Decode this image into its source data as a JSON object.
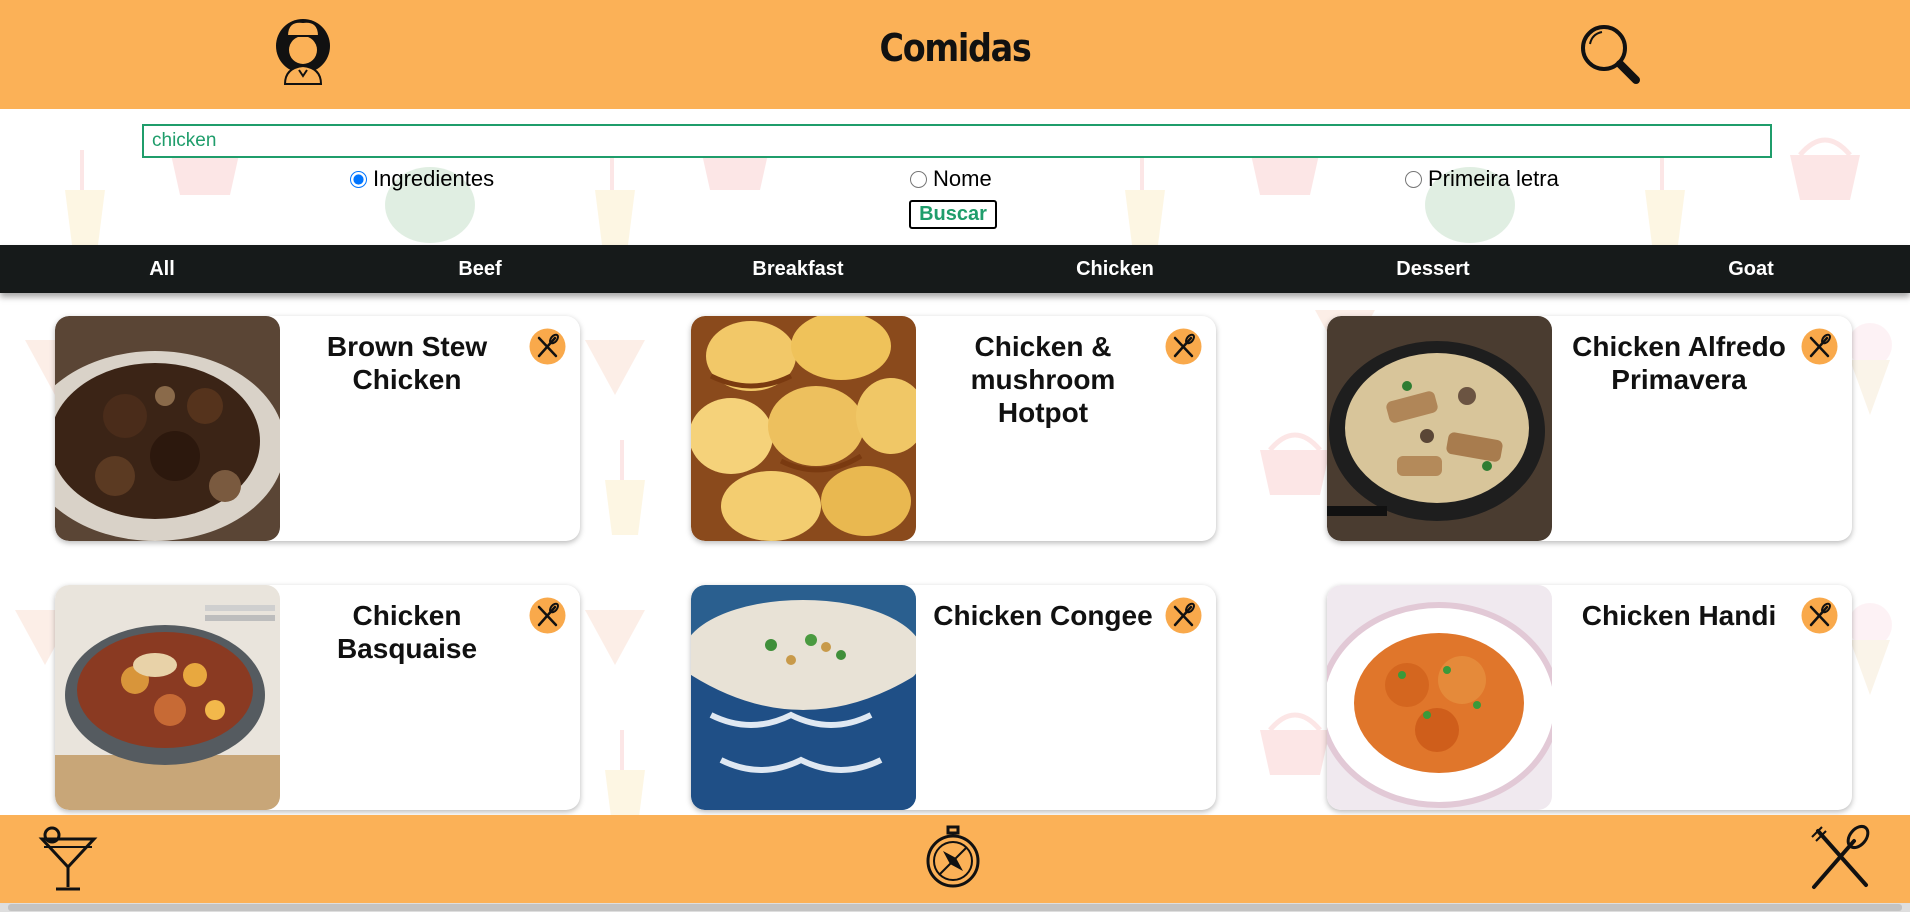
{
  "header": {
    "title": "Comidas",
    "profile_icon": "chef-profile-icon",
    "search_icon": "magnifier-icon"
  },
  "search": {
    "value": "chicken",
    "placeholder": "",
    "options": [
      {
        "label": "Ingredientes",
        "checked": true
      },
      {
        "label": "Nome",
        "checked": false
      },
      {
        "label": "Primeira letra",
        "checked": false
      }
    ],
    "button_label": "Buscar"
  },
  "categories": [
    "All",
    "Beef",
    "Breakfast",
    "Chicken",
    "Dessert",
    "Goat"
  ],
  "recipes": [
    {
      "title": "Brown Stew Chicken"
    },
    {
      "title": "Chicken & mushroom Hotpot"
    },
    {
      "title": "Chicken Alfredo Primavera"
    },
    {
      "title": "Chicken Basquaise"
    },
    {
      "title": "Chicken Congee"
    },
    {
      "title": "Chicken Handi"
    }
  ],
  "footer": {
    "drinks_icon": "cocktail-glass-icon",
    "explore_icon": "compass-icon",
    "foods_icon": "fork-spoon-icon"
  },
  "colors": {
    "header_bg": "#fbb157",
    "category_bar_bg": "#161a1a",
    "accent_green": "#1f9d6b",
    "fav_icon_bg": "#f9a94b"
  }
}
